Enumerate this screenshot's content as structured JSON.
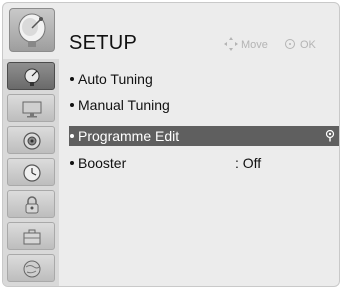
{
  "header": {
    "title": "SETUP",
    "hint_move_label": "Move",
    "hint_ok_label": "OK",
    "logo_icon": "satellite-dish-icon"
  },
  "sidebar": {
    "items": [
      {
        "icon": "satellite-dish-icon",
        "active": true
      },
      {
        "icon": "monitor-icon",
        "active": false
      },
      {
        "icon": "speaker-icon",
        "active": false
      },
      {
        "icon": "clock-icon",
        "active": false
      },
      {
        "icon": "lock-icon",
        "active": false
      },
      {
        "icon": "briefcase-icon",
        "active": false
      },
      {
        "icon": "globe-icon",
        "active": false
      }
    ]
  },
  "menu": {
    "items": [
      {
        "label": "Auto Tuning",
        "value": ""
      },
      {
        "label": "Manual Tuning",
        "value": ""
      },
      {
        "label": "Programme Edit",
        "value": "",
        "selected": true
      },
      {
        "label": "Booster",
        "value": ": Off"
      }
    ]
  },
  "colors": {
    "selected_row": "#5f5f5f",
    "hint_text": "#b4b4b4",
    "panel_background": "#ececec"
  }
}
